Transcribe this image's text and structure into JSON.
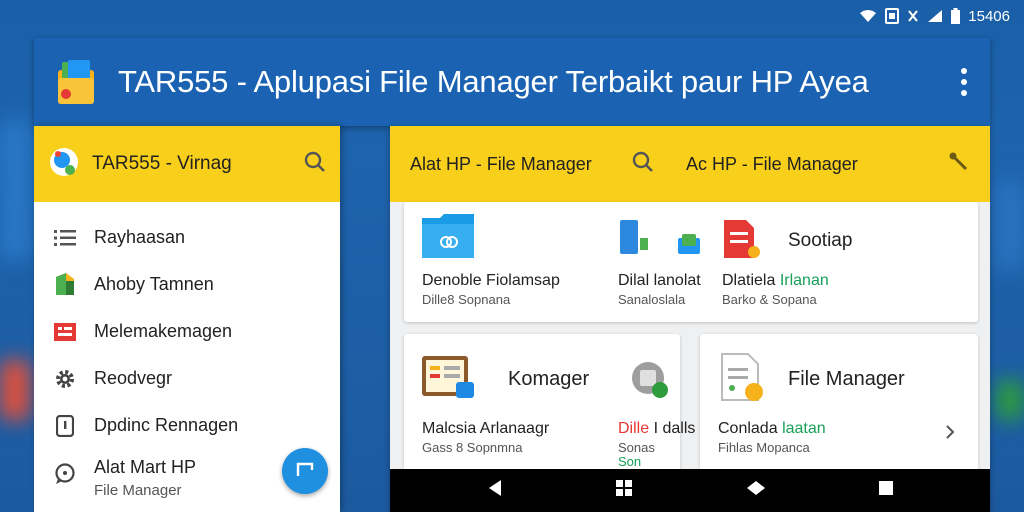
{
  "status_bar": {
    "time": "15406"
  },
  "app_bar": {
    "title": "TAR555 - Aplupasi File Manager Terbaikt paur HP Ayea"
  },
  "drawer": {
    "title": "TAR555 - Virnag",
    "items": [
      {
        "label": "Rayhaasan",
        "icon": "list-icon"
      },
      {
        "label": "Ahoby Tamnen",
        "icon": "drive-icon"
      },
      {
        "label": "Melemakemagen",
        "icon": "folder-red-icon"
      },
      {
        "label": "Reodvegr",
        "icon": "gear-icon"
      },
      {
        "label": "Dpdinc Rennagen",
        "icon": "doc-icon"
      },
      {
        "label": "Alat Mart HP",
        "sub": "File Manager",
        "icon": "chat-icon"
      }
    ]
  },
  "main": {
    "header_left": "Alat HP - File Manager",
    "header_right": "Ac HP - File Manager",
    "card1": {
      "left_title": "Denoble Fiolamsap",
      "left_sub": "Dille8 Sopnana",
      "mid_title": "Dilal lanolat",
      "mid_sub": "Sanaloslala",
      "right_big": "Sootiap",
      "right_title_a": "Dlatiela",
      "right_title_b": "Irlanan",
      "right_sub": "Barko & Sopana"
    },
    "card2": {
      "big": "Komager",
      "left_title": "Malcsia Arlanaagr",
      "left_sub": "Gass 8 Sopnmna",
      "mid_title_a": "Dille",
      "mid_title_b": "I dalls",
      "mid_sub": "Sonas",
      "mid_sub2": "Son"
    },
    "card3": {
      "big": "File Manager",
      "title_a": "Conlada",
      "title_b": "laatan",
      "sub": "Fihlas Mopanca"
    }
  },
  "colors": {
    "primary": "#1b63b2",
    "accent": "#f8cf1a",
    "fab": "#1f8fe0"
  }
}
